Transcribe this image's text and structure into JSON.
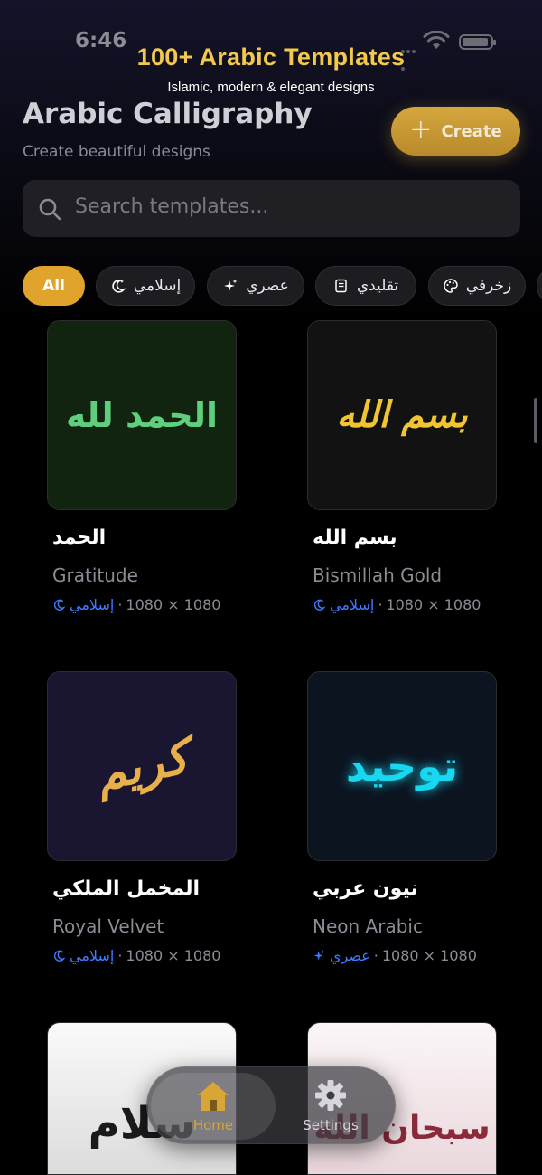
{
  "status_bar": {
    "time": "6:46"
  },
  "banner": {
    "title": "100+ Arabic Templates",
    "subtitle": "Islamic, modern & elegant designs"
  },
  "header": {
    "title": "Arabic Calligraphy",
    "subtitle": "Create beautiful designs",
    "create_label": "Create"
  },
  "search": {
    "placeholder": "Search templates..."
  },
  "filters": [
    {
      "label": "All",
      "active": true,
      "icon": "none"
    },
    {
      "label": "إسلامي",
      "icon": "moon-star-icon"
    },
    {
      "label": "عصري",
      "icon": "sparkle-icon"
    },
    {
      "label": "تقليدي",
      "icon": "scroll-icon"
    },
    {
      "label": "زخرفي",
      "icon": "palette-icon"
    }
  ],
  "templates": [
    {
      "arabic": "الحمد لله",
      "title": "الحمد",
      "name": "Gratitude",
      "tag": "إسلامي",
      "tag_icon": "moon-star-icon",
      "size": "1080 × 1080",
      "bg": "#10240f",
      "ink": "#5fcf7d"
    },
    {
      "arabic": "بسم الله",
      "title": "بسم الله",
      "name": "Bismillah Gold",
      "tag": "إسلامي",
      "tag_icon": "moon-star-icon",
      "size": "1080 × 1080",
      "bg": "#121212",
      "ink": "#f0c531"
    },
    {
      "arabic": "كريم",
      "title": "المخمل الملكي",
      "name": "Royal Velvet",
      "tag": "إسلامي",
      "tag_icon": "moon-star-icon",
      "size": "1080 × 1080",
      "bg": "#1a1530",
      "ink": "#e7b04a"
    },
    {
      "arabic": "توحيد",
      "title": "نيون عربي",
      "name": "Neon Arabic",
      "tag": "عصري",
      "tag_icon": "sparkle-icon",
      "size": "1080 × 1080",
      "bg": "#0c1420",
      "ink": "#17d8f0"
    },
    {
      "arabic": "سلام",
      "bg": "#f2f2f2",
      "ink": "#1a1a1a"
    },
    {
      "arabic": "سبحان الله",
      "bg": "#f6eef0",
      "ink": "#8a2a3a"
    }
  ],
  "tabbar": {
    "home_label": "Home",
    "settings_label": "Settings"
  },
  "colors": {
    "accent": "#e0a32c",
    "banner_gold": "#f2c94c",
    "tag_blue": "#3d7bff"
  }
}
